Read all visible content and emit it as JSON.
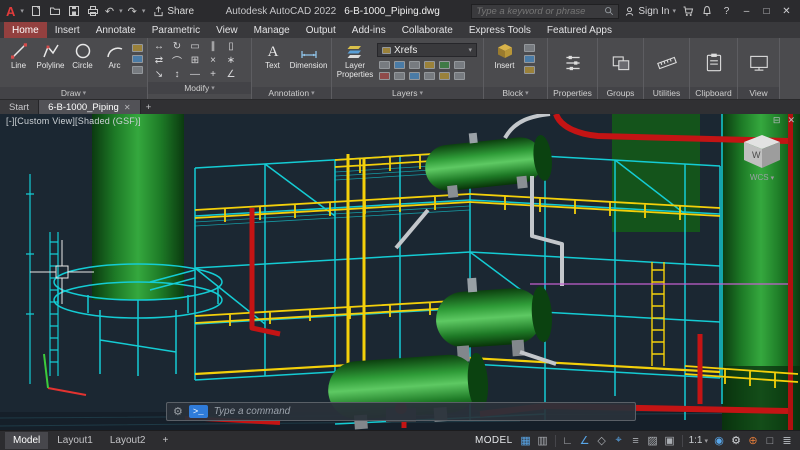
{
  "colors": {
    "accent_red": "#c21d28",
    "active_tab": "#93403f",
    "ribbon_bg": "#4b4b4e",
    "viewport_bg": "#1b2732",
    "structure_cyan": "#14ccd4",
    "handrail_yellow": "#f4d00a",
    "pipe_red": "#c41414",
    "vessel_green": "#2f9c38",
    "status_active_blue": "#58a6e8"
  },
  "titlebar": {
    "share_label": "Share",
    "app_title": "Autodesk AutoCAD 2022",
    "doc_title": "6-B-1000_Piping.dwg",
    "search_placeholder": "Type a keyword or phrase",
    "sign_in_label": "Sign In",
    "quick_access_icon_names": [
      "autocad-logo",
      "new-drawing",
      "open",
      "save",
      "plot",
      "undo",
      "redo",
      "share"
    ],
    "right_icon_names": [
      "search",
      "sign-in",
      "cart",
      "bell",
      "help",
      "minimize",
      "maximize",
      "close"
    ],
    "help_glyph": "?",
    "minimize_glyph": "–",
    "maximize_glyph": "□",
    "close_glyph": "✕"
  },
  "ribbon": {
    "tabs": [
      {
        "label": "Home",
        "active": true
      },
      {
        "label": "Insert"
      },
      {
        "label": "Annotate"
      },
      {
        "label": "Parametric"
      },
      {
        "label": "View"
      },
      {
        "label": "Manage"
      },
      {
        "label": "Output"
      },
      {
        "label": "Add-ins"
      },
      {
        "label": "Collaborate"
      },
      {
        "label": "Express Tools"
      },
      {
        "label": "Featured Apps"
      }
    ],
    "panels": {
      "draw": {
        "title": "Draw",
        "tools": [
          {
            "label": "Line"
          },
          {
            "label": "Polyline"
          },
          {
            "label": "Circle"
          },
          {
            "label": "Arc"
          }
        ],
        "extra_icon_names": [
          "hatch",
          "gradient",
          "boundary"
        ]
      },
      "modify": {
        "title": "Modify",
        "icons": [
          {
            "name": "move",
            "glyph": "↔"
          },
          {
            "name": "rotate",
            "glyph": "↻"
          },
          {
            "name": "trim",
            "glyph": "▭"
          },
          {
            "name": "offset",
            "glyph": "∥"
          },
          {
            "name": "copy",
            "glyph": "▯"
          },
          {
            "name": "mirror",
            "glyph": "⇄"
          },
          {
            "name": "fillet",
            "glyph": "⌒"
          },
          {
            "name": "array",
            "glyph": "⊞"
          },
          {
            "name": "erase",
            "glyph": "×"
          },
          {
            "name": "explode",
            "glyph": "∗"
          },
          {
            "name": "stretch",
            "glyph": "↘"
          },
          {
            "name": "scale",
            "glyph": "↕"
          },
          {
            "name": "break",
            "glyph": "—"
          },
          {
            "name": "join",
            "glyph": "+"
          },
          {
            "name": "chamfer",
            "glyph": "∠"
          }
        ]
      },
      "annotation": {
        "title": "Annotation",
        "tools": [
          {
            "label": "Text"
          },
          {
            "label": "Dimension"
          }
        ],
        "extra_icon_names": [
          "leader",
          "table",
          "multileader"
        ]
      },
      "layers": {
        "title": "Layers",
        "main_tool_label": "Layer Properties",
        "dropdown_value": "Xrefs",
        "mini_icon_names": [
          "layer-off",
          "layer-isolate",
          "layer-freeze",
          "layer-lock",
          "make-current",
          "match-layer",
          "layer-on",
          "layer-unisolate",
          "layer-thaw",
          "layer-unlock",
          "layer-walk",
          "layer-previous"
        ]
      },
      "block": {
        "title": "Block",
        "main_tool_label": "Insert",
        "extra_icon_names": [
          "edit-block",
          "define-attributes",
          "create-block"
        ]
      },
      "properties": {
        "title": "Properties"
      },
      "groups": {
        "title": "Groups"
      },
      "utilities": {
        "title": "Utilities"
      },
      "clipboard": {
        "title": "Clipboard"
      },
      "view_panel": {
        "title": "View"
      }
    }
  },
  "doc_tabs": {
    "tabs": [
      {
        "label": "Start"
      },
      {
        "label": "6-B-1000_Piping",
        "active": true
      }
    ],
    "new_tab_glyph": "+",
    "close_glyph": "✕"
  },
  "viewport": {
    "controls_label": "[-][Custom View][Shaded (GSF)]",
    "viewcube_face": "W",
    "ucs_label": "WCS",
    "window_minimize_glyph": "⊟",
    "window_close_glyph": "✕"
  },
  "command_line": {
    "placeholder": "Type a command",
    "prompt_glyph": ">_",
    "customize_glyph": "⚙"
  },
  "statusbar": {
    "layout_tabs": [
      {
        "label": "Model",
        "active": true
      },
      {
        "label": "Layout1"
      },
      {
        "label": "Layout2"
      }
    ],
    "new_layout_glyph": "+",
    "space_label": "MODEL",
    "scale_label": "1:1",
    "icons": [
      {
        "name": "grid",
        "glyph": "▦",
        "active": true
      },
      {
        "name": "snap",
        "glyph": "▥",
        "active": false
      },
      {
        "name": "ortho",
        "glyph": "∟",
        "active": false
      },
      {
        "name": "polar-tracking",
        "glyph": "∠",
        "active": true
      },
      {
        "name": "isodraft",
        "glyph": "◇",
        "active": false
      },
      {
        "name": "object-snap",
        "glyph": "⌖",
        "active": true
      },
      {
        "name": "lineweight",
        "glyph": "≡",
        "active": false
      },
      {
        "name": "transparency",
        "glyph": "▨",
        "active": false
      },
      {
        "name": "selection-cycling",
        "glyph": "▣",
        "active": false
      },
      {
        "name": "annotation-visibility",
        "glyph": "◉",
        "active": true
      },
      {
        "name": "workspace",
        "glyph": "⚙",
        "active": false
      },
      {
        "name": "annotation-monitor",
        "glyph": "⊕",
        "active": false
      },
      {
        "name": "clean-screen",
        "glyph": "□",
        "active": false
      },
      {
        "name": "customization",
        "glyph": "≣",
        "active": false
      }
    ]
  }
}
